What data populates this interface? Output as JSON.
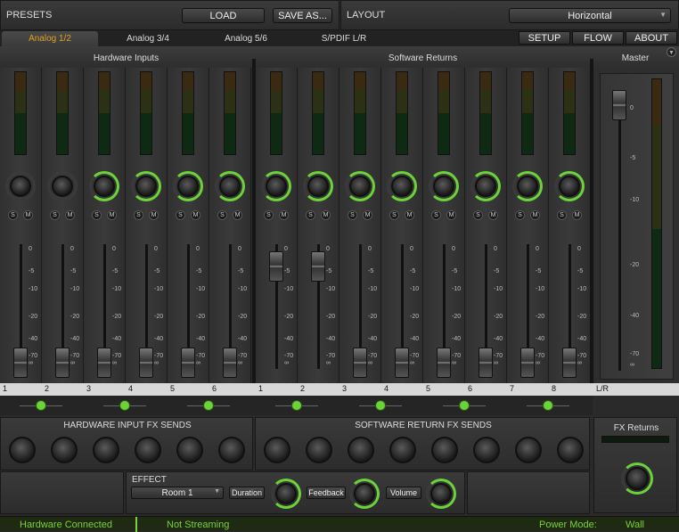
{
  "presets": {
    "label": "PRESETS",
    "load": "LOAD",
    "save_as": "SAVE AS..."
  },
  "layout": {
    "label": "LAYOUT",
    "selected": "Horizontal"
  },
  "tabs": [
    "Analog 1/2",
    "Analog 3/4",
    "Analog 5/6",
    "S/PDIF L/R"
  ],
  "nav": {
    "setup": "SETUP",
    "flow": "FLOW",
    "about": "ABOUT"
  },
  "sections": {
    "hardware_inputs": "Hardware Inputs",
    "software_returns": "Software Returns",
    "master": "Master"
  },
  "strip_buttons": {
    "solo": "S",
    "mute": "M"
  },
  "fader_scale": [
    "0",
    "-5",
    "-10",
    "-20",
    "-40",
    "-70",
    "∞"
  ],
  "master_scale": [
    "0",
    "-5",
    "-10",
    "-20",
    "-40",
    "-70",
    "∞"
  ],
  "channel_numbers": [
    "1",
    "2",
    "3",
    "4",
    "5",
    "6",
    "1",
    "2",
    "3",
    "4",
    "5",
    "6",
    "7",
    "8"
  ],
  "master_channel": "L/R",
  "channel_levels": [
    {
      "fader": 0.05,
      "knob_active": false
    },
    {
      "fader": 0.05,
      "knob_active": false
    },
    {
      "fader": 0.05,
      "knob_active": true
    },
    {
      "fader": 0.05,
      "knob_active": true
    },
    {
      "fader": 0.05,
      "knob_active": true
    },
    {
      "fader": 0.05,
      "knob_active": true
    },
    {
      "fader": 0.82,
      "knob_active": true
    },
    {
      "fader": 0.82,
      "knob_active": true
    },
    {
      "fader": 0.05,
      "knob_active": true
    },
    {
      "fader": 0.05,
      "knob_active": true
    },
    {
      "fader": 0.05,
      "knob_active": true
    },
    {
      "fader": 0.05,
      "knob_active": true
    },
    {
      "fader": 0.05,
      "knob_active": true
    },
    {
      "fader": 0.05,
      "knob_active": true
    }
  ],
  "fx": {
    "hw_sends": "HARDWARE INPUT FX SENDS",
    "sw_sends": "SOFTWARE RETURN FX SENDS",
    "returns": "FX Returns"
  },
  "effect": {
    "label": "EFFECT",
    "room": "Room 1",
    "duration": "Duration",
    "feedback": "Feedback",
    "volume": "Volume"
  },
  "status": {
    "hardware": "Hardware Connected",
    "streaming": "Not Streaming",
    "power_label": "Power Mode:",
    "power_value": "Wall"
  },
  "colors": {
    "accent": "#6bd23a",
    "status_text": "#7bd13a"
  }
}
